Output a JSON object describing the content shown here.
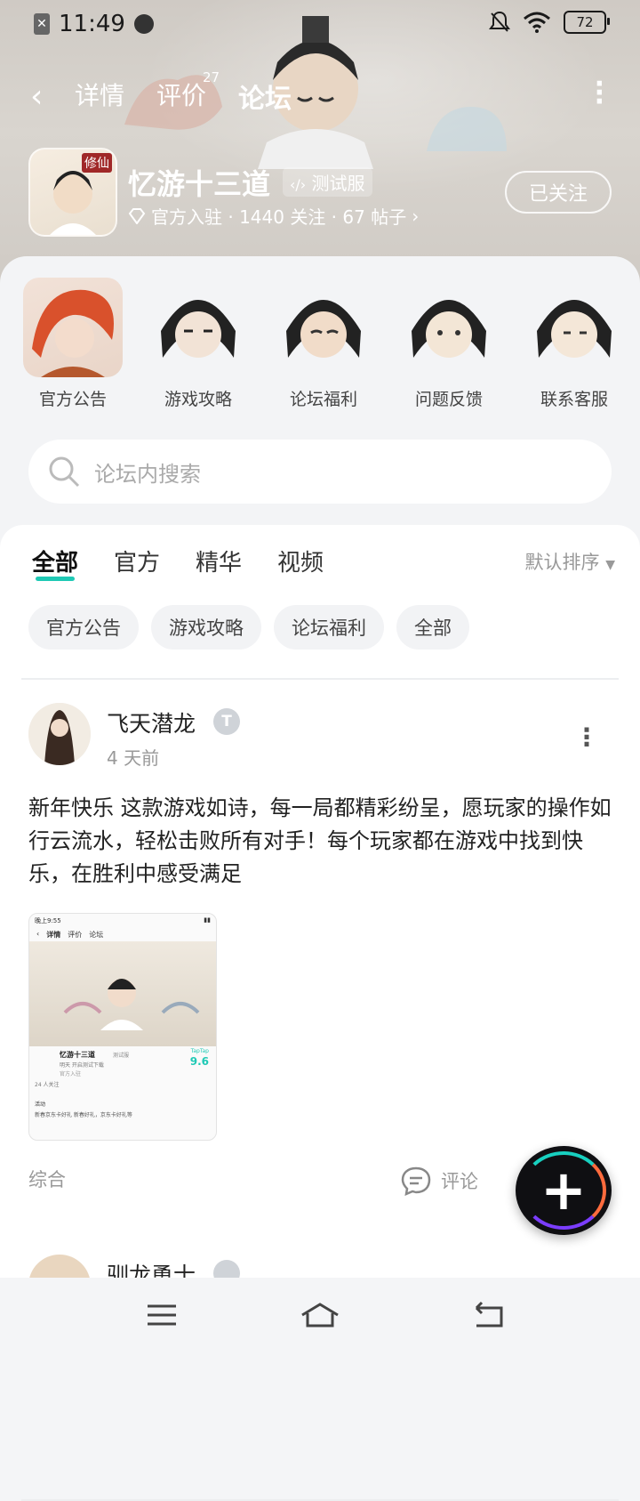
{
  "status_bar": {
    "time": "11:49",
    "battery": "72"
  },
  "nav": {
    "tabs": [
      {
        "label": "详情"
      },
      {
        "label": "评价"
      },
      {
        "label": "论坛"
      }
    ],
    "review_count": "27"
  },
  "game": {
    "icon_text": "修仙",
    "name": "忆游十三道",
    "tag": "测试服",
    "meta": "官方入驻 · 1440 关注 · 67 帖子",
    "follow_label": "已关注"
  },
  "shortcuts": [
    {
      "label": "官方公告"
    },
    {
      "label": "游戏攻略"
    },
    {
      "label": "论坛福利"
    },
    {
      "label": "问题反馈"
    },
    {
      "label": "联系客服"
    }
  ],
  "search": {
    "placeholder": "论坛内搜索"
  },
  "feed": {
    "tabs": [
      "全部",
      "官方",
      "精华",
      "视频"
    ],
    "sort_label": "默认排序",
    "chips": [
      "官方公告",
      "游戏攻略",
      "论坛福利",
      "全部"
    ]
  },
  "post": {
    "author": "飞天潜龙",
    "time": "4 天前",
    "text": "新年快乐  这款游戏如诗，每一局都精彩纷呈，愿玩家的操作如行云流水，轻松击败所有对手！每个玩家都在游戏中找到快乐，在胜利中感受满足",
    "category": "综合",
    "comment_label": "评论",
    "thumb": {
      "status_time": "晚上9:55",
      "tab_detail": "详情",
      "tab_review": "评价",
      "tab_forum": "论坛",
      "game_name": "忆游十三道",
      "tag": "测试服",
      "subtitle": "明天 开启测试下载",
      "official": "官方入驻",
      "score_brand": "TapTap",
      "score": "9.6",
      "follow": "24 人关注",
      "event": "活动",
      "banner": "新春京东卡好礼 新春好礼，京东卡好礼等"
    }
  },
  "post2": {
    "author": "驯龙勇士"
  }
}
